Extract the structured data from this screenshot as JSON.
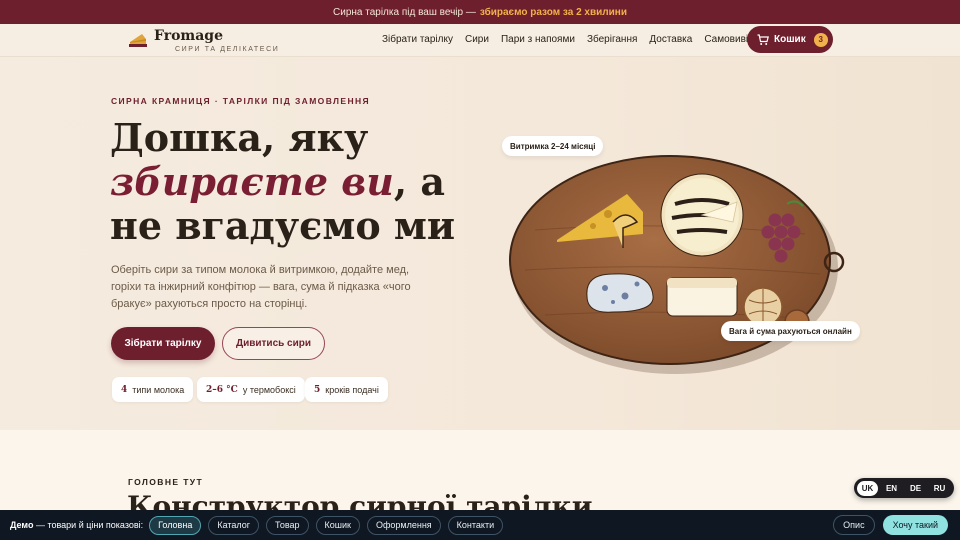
{
  "topbar": {
    "text": "Сирна тарілка під ваш вечір —",
    "highlight": "збираємо разом за 2 хвилини"
  },
  "header": {
    "logo_name": "Fromage",
    "logo_sub": "СИРИ ТА ДЕЛІКАТЕСИ",
    "nav": [
      "Зібрати тарілку",
      "Сири",
      "Пари з напоями",
      "Зберігання",
      "Доставка",
      "Самовивіз"
    ],
    "cart_label": "Кошик",
    "cart_count": "3"
  },
  "hero": {
    "eyebrow": "СИРНА КРАМНИЦЯ · ТАРІЛКИ ПІД ЗАМОВЛЕННЯ",
    "title_line1": "Дошка, яку",
    "title_accent": "збираєте ви",
    "title_after_accent": ", а",
    "title_line3": "не вгадуємо ми",
    "lead": "Оберіть сири за типом молока й витримкою, додайте мед, горіхи та інжирний конфітюр — вага, сума й підказка «чого бракує» рахуються просто на сторінці.",
    "primary_button": "Зібрати тарілку",
    "secondary_button": "Дивитись сири",
    "stats": [
      {
        "value": "4",
        "label": "типи молока"
      },
      {
        "value": "2–6 °C",
        "label": "у термобоксі"
      },
      {
        "value": "5",
        "label": "кроків подачі"
      }
    ],
    "board_tag_top": "Витримка 2–24 місяці",
    "board_tag_bottom": "Вага й сума рахуються онлайн"
  },
  "section2": {
    "eyebrow": "ГОЛОВНЕ ТУТ",
    "title": "Конструктор сирної тарілки"
  },
  "lang_switch": {
    "options": [
      "UK",
      "EN",
      "DE",
      "RU"
    ],
    "active": "UK"
  },
  "demo_bar": {
    "label_bold": "Демо",
    "label_rest": "— товари й ціни показові:",
    "chips": [
      "Головна",
      "Каталог",
      "Товар",
      "Кошик",
      "Оформлення",
      "Контакти"
    ],
    "active_chip": "Головна",
    "about": "Опис",
    "want": "Хочу такий"
  },
  "colors": {
    "accent": "#6e1f2e",
    "gold": "#f2b24a",
    "cream": "#f6ede2",
    "demo_bg": "#0e1722"
  }
}
